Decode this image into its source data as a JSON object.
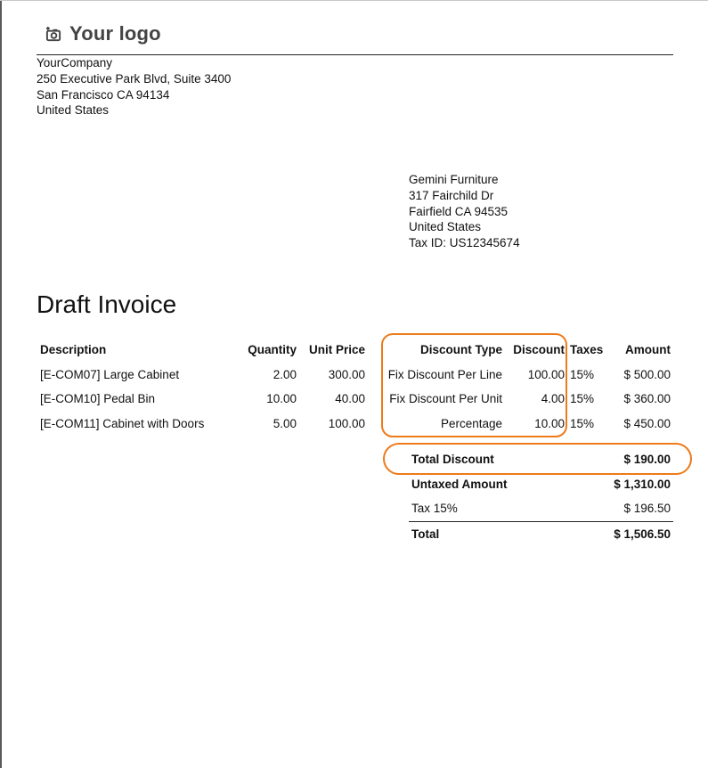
{
  "logo": {
    "text": "Your logo",
    "icon": "camera-icon"
  },
  "company": {
    "name": "YourCompany",
    "street": "250 Executive Park Blvd, Suite 3400",
    "city": "San Francisco CA 94134",
    "country": "United States"
  },
  "customer": {
    "name": "Gemini Furniture",
    "street": "317 Fairchild Dr",
    "city": "Fairfield CA 94535",
    "country": "United States",
    "tax_id": "Tax ID: US12345674"
  },
  "title": "Draft Invoice",
  "table": {
    "headers": {
      "description": "Description",
      "quantity": "Quantity",
      "unit_price": "Unit Price",
      "discount_type": "Discount Type",
      "discount": "Discount",
      "taxes": "Taxes",
      "amount": "Amount"
    },
    "rows": [
      {
        "description": "[E-COM07] Large Cabinet",
        "quantity": "2.00",
        "unit_price": "300.00",
        "discount_type": "Fix Discount Per Line",
        "discount": "100.00",
        "taxes": "15%",
        "amount": "$ 500.00"
      },
      {
        "description": "[E-COM10] Pedal Bin",
        "quantity": "10.00",
        "unit_price": "40.00",
        "discount_type": "Fix Discount Per Unit",
        "discount": "4.00",
        "taxes": "15%",
        "amount": "$ 360.00"
      },
      {
        "description": "[E-COM11] Cabinet with Doors",
        "quantity": "5.00",
        "unit_price": "100.00",
        "discount_type": "Percentage",
        "discount": "10.00",
        "taxes": "15%",
        "amount": "$ 450.00"
      }
    ]
  },
  "totals": {
    "total_discount_label": "Total Discount",
    "total_discount": "$ 190.00",
    "untaxed_label": "Untaxed Amount",
    "untaxed": "$ 1,310.00",
    "tax_label": "Tax 15%",
    "tax": "$ 196.50",
    "total_label": "Total",
    "total": "$ 1,506.50"
  },
  "highlight_color": "#ee7a1a"
}
